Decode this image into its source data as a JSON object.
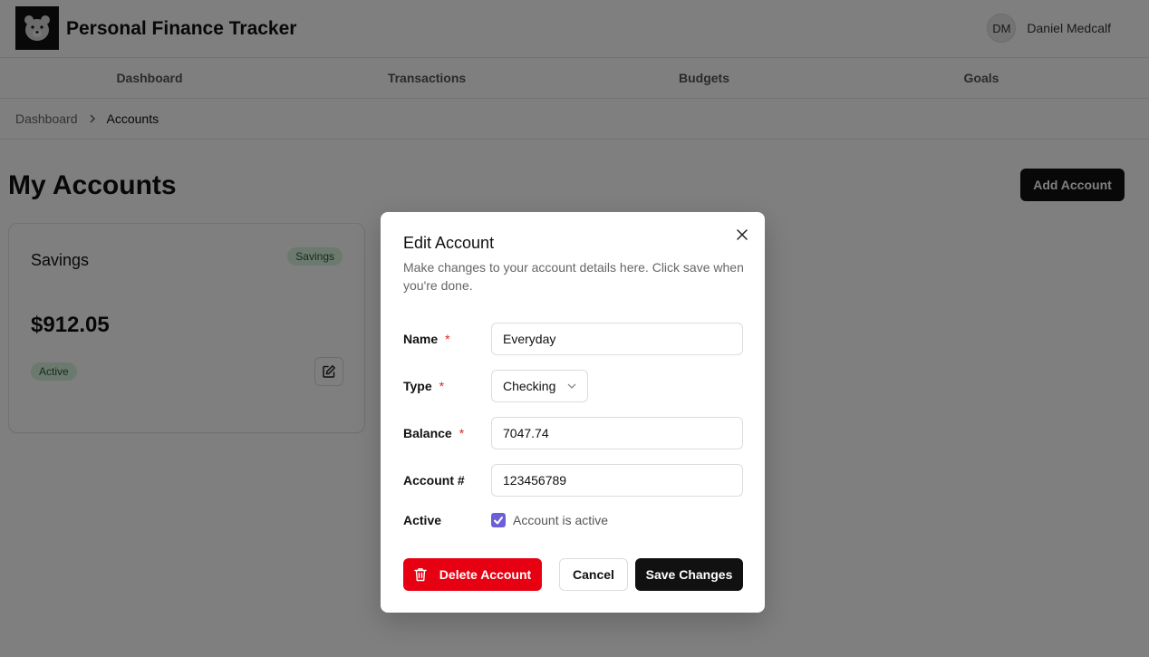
{
  "header": {
    "app_title": "Personal Finance Tracker",
    "logo_icon": "bear-logo-icon",
    "user": {
      "initials": "DM",
      "name": "Daniel Medcalf"
    }
  },
  "nav": {
    "items": [
      {
        "label": "Dashboard"
      },
      {
        "label": "Transactions"
      },
      {
        "label": "Budgets"
      },
      {
        "label": "Goals"
      }
    ]
  },
  "breadcrumb": {
    "items": [
      {
        "label": "Dashboard"
      },
      {
        "label": "Accounts"
      }
    ],
    "separator_icon": "chevron-right-icon"
  },
  "page": {
    "title": "My Accounts",
    "add_button_label": "Add Account"
  },
  "accounts": [
    {
      "name": "Savings",
      "type_badge": "Savings",
      "balance": "$912.05",
      "status": "Active",
      "edit_icon": "edit-icon"
    }
  ],
  "dialog": {
    "title": "Edit Account",
    "description": "Make changes to your account details here. Click save when you're done.",
    "required_marker": "*",
    "fields": {
      "name": {
        "label": "Name",
        "value": "Everyday"
      },
      "type": {
        "label": "Type",
        "value": "Checking"
      },
      "balance": {
        "label": "Balance",
        "value": "7047.74"
      },
      "account_number": {
        "label": "Account #",
        "value": "123456789"
      },
      "active": {
        "label": "Active",
        "checkbox_label": "Account is active",
        "checked": true
      }
    },
    "buttons": {
      "delete": "Delete Account",
      "cancel": "Cancel",
      "save": "Save Changes"
    }
  },
  "colors": {
    "primary": "#111111",
    "danger": "#e60012",
    "badge_bg": "#d9f2df",
    "checkbox": "#6d5fd6"
  }
}
